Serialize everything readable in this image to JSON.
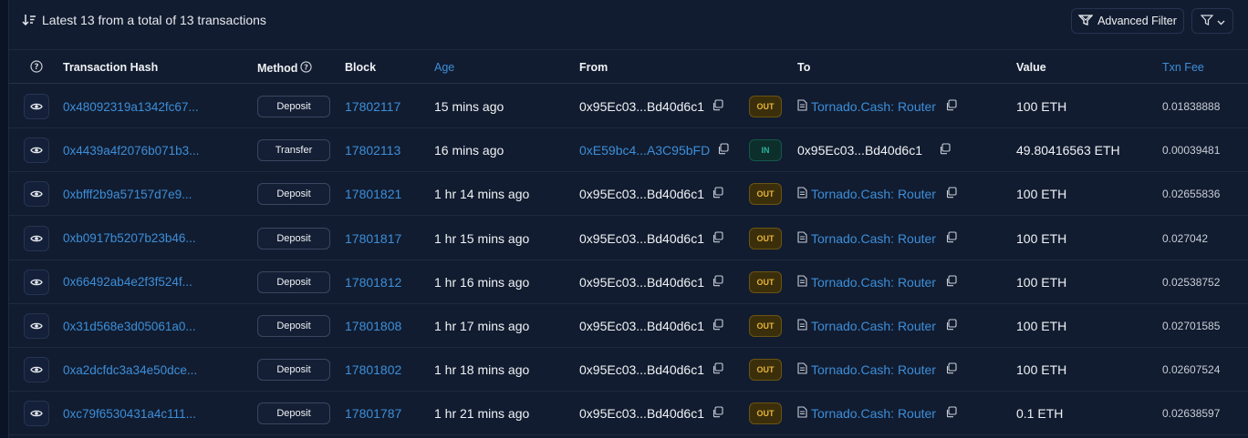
{
  "summary": {
    "text": "Latest 13 from a total of 13 transactions"
  },
  "toolbar": {
    "advanced_filter_label": "Advanced Filter"
  },
  "columns": {
    "hash": "Transaction Hash",
    "method": "Method",
    "block": "Block",
    "age": "Age",
    "from": "From",
    "to": "To",
    "value": "Value",
    "fee": "Txn Fee"
  },
  "rows": [
    {
      "hash": "0x48092319a1342fc67...",
      "method": "Deposit",
      "block": "17802117",
      "age": "15 mins ago",
      "from": "0x95Ec03...Bd40d6c1",
      "from_link": false,
      "direction": "OUT",
      "to": "Tornado.Cash: Router",
      "to_contract": true,
      "value": "100 ETH",
      "fee": "0.01838888"
    },
    {
      "hash": "0x4439a4f2076b071b3...",
      "method": "Transfer",
      "block": "17802113",
      "age": "16 mins ago",
      "from": "0xE59bc4...A3C95bFD",
      "from_link": true,
      "direction": "IN",
      "to": "0x95Ec03...Bd40d6c1",
      "to_contract": false,
      "value": "49.80416563 ETH",
      "fee": "0.00039481"
    },
    {
      "hash": "0xbfff2b9a57157d7e9...",
      "method": "Deposit",
      "block": "17801821",
      "age": "1 hr 14 mins ago",
      "from": "0x95Ec03...Bd40d6c1",
      "from_link": false,
      "direction": "OUT",
      "to": "Tornado.Cash: Router",
      "to_contract": true,
      "value": "100 ETH",
      "fee": "0.02655836"
    },
    {
      "hash": "0xb0917b5207b23b46...",
      "method": "Deposit",
      "block": "17801817",
      "age": "1 hr 15 mins ago",
      "from": "0x95Ec03...Bd40d6c1",
      "from_link": false,
      "direction": "OUT",
      "to": "Tornado.Cash: Router",
      "to_contract": true,
      "value": "100 ETH",
      "fee": "0.027042"
    },
    {
      "hash": "0x66492ab4e2f3f524f...",
      "method": "Deposit",
      "block": "17801812",
      "age": "1 hr 16 mins ago",
      "from": "0x95Ec03...Bd40d6c1",
      "from_link": false,
      "direction": "OUT",
      "to": "Tornado.Cash: Router",
      "to_contract": true,
      "value": "100 ETH",
      "fee": "0.02538752"
    },
    {
      "hash": "0x31d568e3d05061a0...",
      "method": "Deposit",
      "block": "17801808",
      "age": "1 hr 17 mins ago",
      "from": "0x95Ec03...Bd40d6c1",
      "from_link": false,
      "direction": "OUT",
      "to": "Tornado.Cash: Router",
      "to_contract": true,
      "value": "100 ETH",
      "fee": "0.02701585"
    },
    {
      "hash": "0xa2dcfdc3a34e50dce...",
      "method": "Deposit",
      "block": "17801802",
      "age": "1 hr 18 mins ago",
      "from": "0x95Ec03...Bd40d6c1",
      "from_link": false,
      "direction": "OUT",
      "to": "Tornado.Cash: Router",
      "to_contract": true,
      "value": "100 ETH",
      "fee": "0.02607524"
    },
    {
      "hash": "0xc79f6530431a4c111...",
      "method": "Deposit",
      "block": "17801787",
      "age": "1 hr 21 mins ago",
      "from": "0x95Ec03...Bd40d6c1",
      "from_link": false,
      "direction": "OUT",
      "to": "Tornado.Cash: Router",
      "to_contract": true,
      "value": "0.1 ETH",
      "fee": "0.02638597"
    }
  ]
}
